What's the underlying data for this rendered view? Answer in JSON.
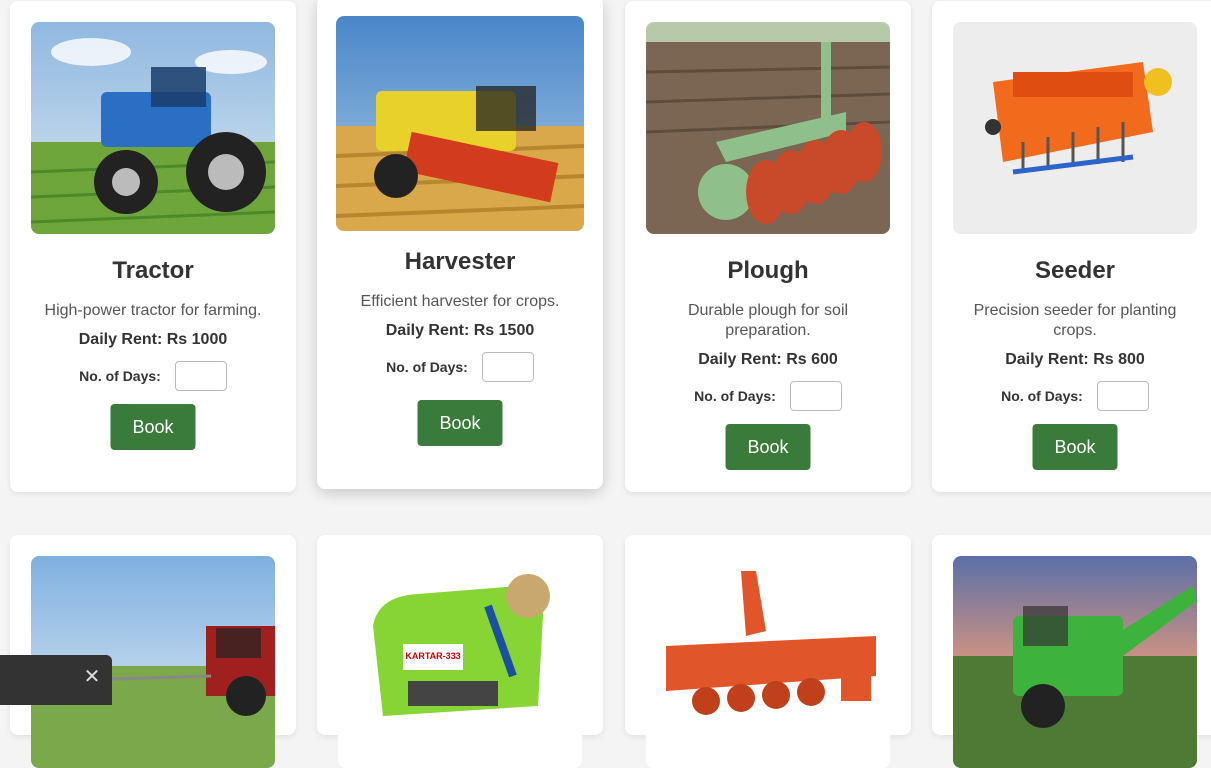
{
  "cards_top": [
    {
      "title": "Tractor",
      "desc": "High-power tractor for farming.",
      "rent": "Daily Rent: Rs 1000",
      "days_label": "No. of Days:",
      "book": "Book",
      "image": "tractor-image"
    },
    {
      "title": "Harvester",
      "desc": "Efficient harvester for crops.",
      "rent": "Daily Rent: Rs 1500",
      "days_label": "No. of Days:",
      "book": "Book",
      "image": "harvester-image"
    },
    {
      "title": "Plough",
      "desc": "Durable plough for soil preparation.",
      "rent": "Daily Rent: Rs 600",
      "days_label": "No. of Days:",
      "book": "Book",
      "image": "plough-image"
    },
    {
      "title": "Seeder",
      "desc": "Precision seeder for planting crops.",
      "rent": "Daily Rent: Rs 800",
      "days_label": "No. of Days:",
      "book": "Book",
      "image": "seeder-image"
    }
  ],
  "cards_bottom": [
    {
      "image": "sprayer-tractor-image"
    },
    {
      "image": "baler-image"
    },
    {
      "image": "rotavator-image"
    },
    {
      "image": "combine-harvester-image"
    }
  ],
  "baler_text": "KARTAR-333",
  "toast": {
    "close_icon": "close-icon",
    "glyph": "✕"
  },
  "colors": {
    "book_button": "#3a7a3a",
    "background": "#f4f4f4",
    "card": "#ffffff"
  }
}
